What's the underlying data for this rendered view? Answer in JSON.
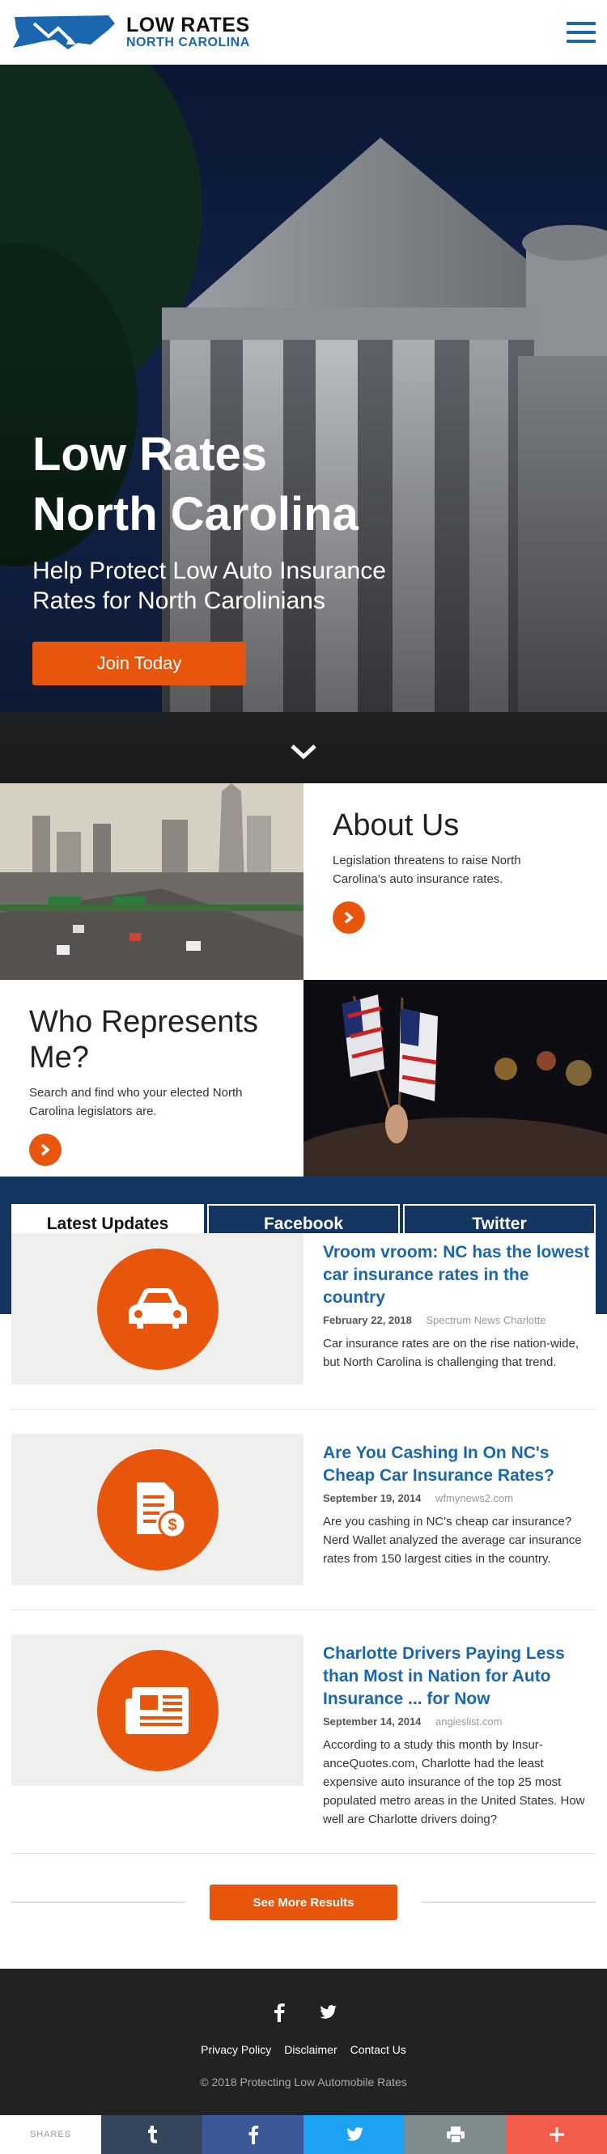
{
  "header": {
    "logo_line1": "LOW RATES",
    "logo_line2": "NORTH CAROLINA",
    "menu_icon": "hamburger-icon"
  },
  "hero": {
    "title_line1": "Low Rates",
    "title_line2": "North Carolina",
    "subtitle_line1": "Help Protect Low Auto Insurance",
    "subtitle_line2": "Rates for North Carolinians",
    "cta_label": "Join Today",
    "scroll_icon": "chevron-down-icon"
  },
  "about": {
    "title": "About Us",
    "desc": "Legislation threatens to raise North Carolina's auto insurance rates."
  },
  "represents": {
    "title": "Who Represents Me?",
    "desc": "Search and find who your elected North Carolina legislators are."
  },
  "tabs": [
    {
      "label": "Latest Updates",
      "active": true
    },
    {
      "label": "Facebook",
      "active": false
    },
    {
      "label": "Twitter",
      "active": false
    }
  ],
  "news": [
    {
      "title": "Vroom vroom: NC has the lowest car insurance rates in the country",
      "date": "February 22, 2018",
      "source": "Spectrum News Charlotte",
      "desc": "Car insurance rates are on the rise nation-wide, but North Carolina is challenging that trend.",
      "icon": "car-icon"
    },
    {
      "title": "Are You Cashing In On NC's Cheap Car Insurance Rates?",
      "date": "September 19, 2014",
      "source": "wfmynews2.com",
      "desc": "Are you cashing in NC's cheap car insurance? Nerd Wallet analyzed the average car insurance rates from 150 largest cities in the country.",
      "icon": "document-dollar-icon"
    },
    {
      "title": "Charlotte Drivers Paying Less than Most in Nation for Auto Insurance ... for Now",
      "date": "September 14, 2014",
      "source": "angieslist.com",
      "desc": "According to a study this month by Insur-anceQuotes.com, Charlotte had the least expensive auto insurance of the top 25 most populated metro areas in the United States. How well are Charlotte drivers doing?",
      "icon": "newspaper-icon"
    }
  ],
  "see_more_label": "See More Results",
  "footer": {
    "links": [
      "Privacy Policy",
      "Disclaimer",
      "Contact Us"
    ],
    "copyright": "© 2018 Protecting Low Automobile Rates"
  },
  "share_bar": {
    "label": "SHARES",
    "buttons": [
      {
        "icon": "tumblr-icon",
        "color": "#35465c"
      },
      {
        "icon": "facebook-icon",
        "color": "#3b5998"
      },
      {
        "icon": "twitter-icon",
        "color": "#1da1f2"
      },
      {
        "icon": "print-icon",
        "color": "#7f8c8d"
      },
      {
        "icon": "plus-icon",
        "color": "#f25c4a"
      }
    ]
  },
  "colors": {
    "accent": "#e8550c",
    "brand_blue": "#1a67b0",
    "band_navy": "#12365f"
  }
}
